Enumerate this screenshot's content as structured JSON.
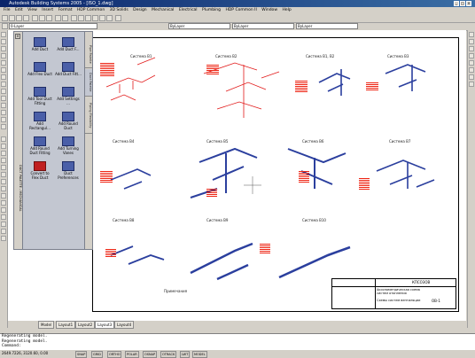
{
  "window": {
    "title": "Autodesk Building Systems 2005 - [ISO_1.dwg]"
  },
  "menu": [
    "File",
    "Edit",
    "View",
    "Insert",
    "Format",
    "HDP Common",
    "3D Solids",
    "Design",
    "Mechanical",
    "Electrical",
    "Plumbing",
    "HDP Common II",
    "Window",
    "Help"
  ],
  "toolbar": {
    "layer_value": "0-Layer",
    "style_value": "ByLayer",
    "linetype_value": "ByLayer"
  },
  "palette": {
    "title": "DUCT PALETTE - MECHANICAL",
    "tools": [
      "Add Duct",
      "Add Duct F...",
      "Add Flex Duct",
      "Add Duct Fitt...",
      "Add Tool Duct Fitting",
      "Add Settings ...",
      "Add Rectangul...",
      "Add Round Duct",
      "Add Round Duct Fitting",
      "Add Turning Vanes",
      "Convert to Flex Duct",
      "Duct Preferences"
    ],
    "tabs": [
      "Pipe Palette",
      "Duct Palette",
      "Piping Flexibility"
    ]
  },
  "drawing": {
    "systems": [
      "Система В1",
      "Система В2",
      "Система В1, В2",
      "Система В3",
      "Система В4",
      "Система В5",
      "Система В6",
      "Система В7",
      "Система В8",
      "Система В9",
      "Система В10"
    ],
    "note_title": "Примечания",
    "titleblock": {
      "code": "КПСО3ОВ",
      "name1": "Аксонометрическая схема систем отопления",
      "name2": "Схемы систем вентиляции",
      "sheet": "ОВ-1"
    }
  },
  "layout_tabs": [
    "Model",
    "Layout1",
    "Layout2",
    "Layout3",
    "Layout4"
  ],
  "command_lines": [
    "Regenerating model.",
    "Regenerating model.",
    "Command:"
  ],
  "status": {
    "coords": "2649.7226, 3120.60, 0.00",
    "buttons": [
      "SNAP",
      "GRID",
      "ORTHO",
      "POLAR",
      "OSNAP",
      "OTRACK",
      "LWT",
      "MODEL"
    ]
  },
  "colors": {
    "accent_red": "#e21a1a",
    "duct_blue": "#2b3f9e",
    "title_blue": "#0a246a"
  }
}
